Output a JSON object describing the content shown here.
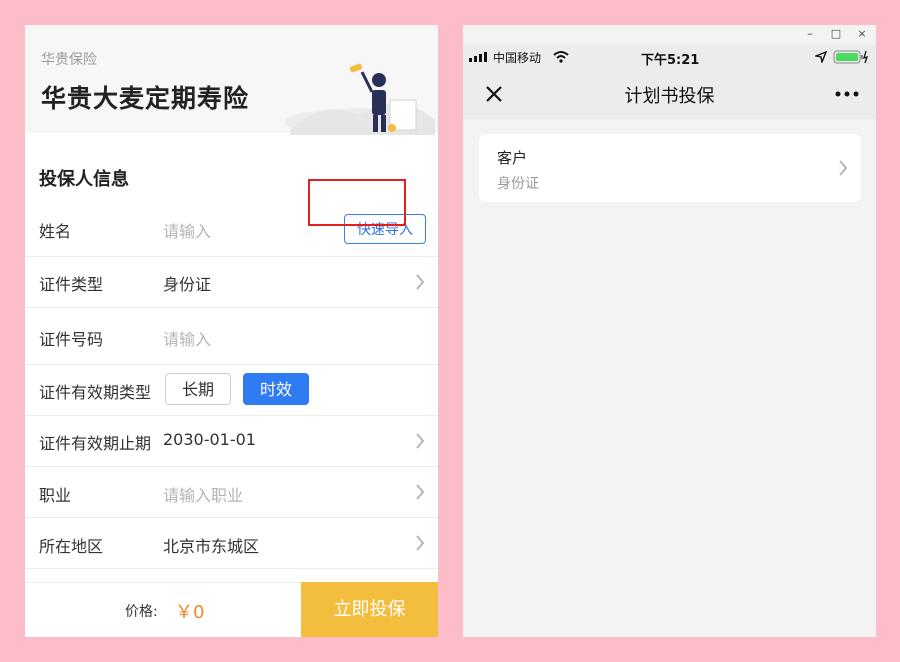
{
  "left": {
    "brand": "华贵保险",
    "product_title": "华贵大麦定期寿险",
    "section_title": "投保人信息",
    "name_row": {
      "label": "姓名",
      "placeholder": "请输入",
      "quick_import": "快速导入"
    },
    "id_type_row": {
      "label": "证件类型",
      "value": "身份证"
    },
    "id_number_row": {
      "label": "证件号码",
      "placeholder": "请输入"
    },
    "validity_type_row": {
      "label": "证件有效期类型",
      "options": [
        "长期",
        "时效"
      ],
      "selected": "时效"
    },
    "expiry_row": {
      "label": "证件有效期止期",
      "value": "2030-01-01"
    },
    "occupation_row": {
      "label": "职业",
      "placeholder": "请输入职业"
    },
    "region_row": {
      "label": "所在地区",
      "value": "北京市东城区"
    },
    "footer": {
      "price_label": "价格:",
      "price_value": "￥0",
      "submit": "立即投保"
    },
    "colors": {
      "accent_blue": "#2f7bf2",
      "highlight_red": "#e02020",
      "submit_yellow": "#f3bd3e",
      "price_orange": "#f08a26"
    }
  },
  "right": {
    "window_controls": [
      "–",
      "□",
      "×"
    ],
    "status": {
      "carrier": "中国移动",
      "time": "下午5:21"
    },
    "nav": {
      "title": "计划书投保",
      "close_icon": "close-icon",
      "more_icon": "more-icon"
    },
    "card": {
      "title": "客户",
      "subtitle": "身份证"
    }
  }
}
